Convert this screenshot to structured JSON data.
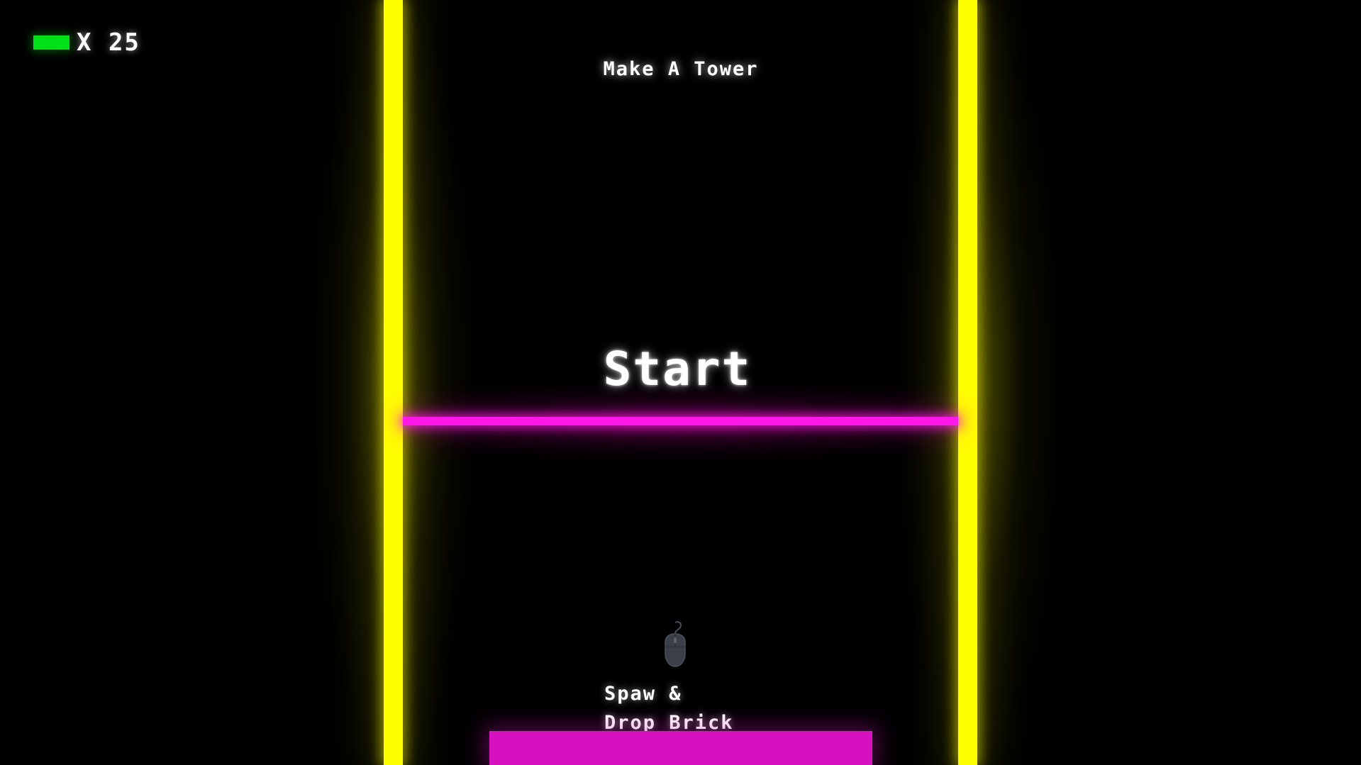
{
  "hud": {
    "brick_count_text": "X 25",
    "brick_count": 25,
    "brick_icon": "green-brick-icon"
  },
  "game": {
    "title": "Make A Tower",
    "start_label": "Start",
    "hint_line1": "Spaw &",
    "hint_line2": "Drop Brick",
    "hint_icon": "mouse-icon"
  },
  "colors": {
    "background": "#000000",
    "walls": "#ffff00",
    "laser": "#ff19e8",
    "base_brick": "#d612c0",
    "brick_icon": "#00e11a",
    "text": "#ffffff"
  }
}
